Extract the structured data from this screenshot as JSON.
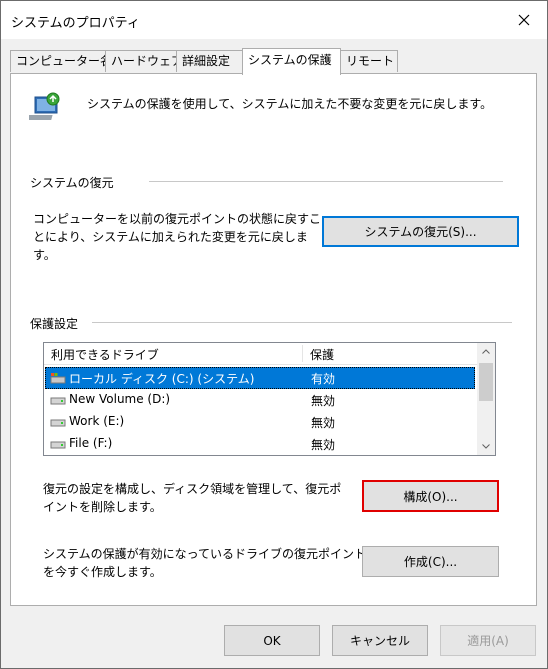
{
  "window": {
    "title": "システムのプロパティ"
  },
  "tabs": [
    {
      "label": "コンピューター名"
    },
    {
      "label": "ハードウェア"
    },
    {
      "label": "詳細設定"
    },
    {
      "label": "システムの保護"
    },
    {
      "label": "リモート"
    }
  ],
  "intro": {
    "text": "システムの保護を使用して、システムに加えた不要な変更を元に戻します。",
    "icon": "system-protection-icon"
  },
  "restore": {
    "title": "システムの復元",
    "description_lines": [
      "コンピューターを以前の復元ポイントの状態に戻すこ",
      "とにより、システムに加えられた変更を元に戻しま",
      "す。"
    ],
    "button": "システムの復元(S)..."
  },
  "protection": {
    "title": "保護設定",
    "columns": [
      "利用できるドライブ",
      "保護"
    ],
    "drives": [
      {
        "name": "ローカル ディスク (C:) (システム)",
        "status": "有効",
        "selected": true,
        "icon": "system-drive-icon"
      },
      {
        "name": "New Volume (D:)",
        "status": "無効",
        "selected": false,
        "icon": "drive-icon"
      },
      {
        "name": "Work (E:)",
        "status": "無効",
        "selected": false,
        "icon": "drive-icon"
      },
      {
        "name": "File (F:)",
        "status": "無効",
        "selected": false,
        "icon": "drive-icon"
      }
    ],
    "configure_text_lines": [
      "復元の設定を構成し、ディスク領域を管理して、復元ポ",
      "イントを削除します。"
    ],
    "configure_button": "構成(O)...",
    "create_text_lines": [
      "システムの保護が有効になっているドライブの復元ポイント",
      "を今すぐ作成します。"
    ],
    "create_button": "作成(C)..."
  },
  "footer": {
    "ok": "OK",
    "cancel": "キャンセル",
    "apply": "適用(A)"
  },
  "colors": {
    "selection": "#0078d7",
    "focus_blue": "#0078d7",
    "highlight_red": "#e00000"
  }
}
